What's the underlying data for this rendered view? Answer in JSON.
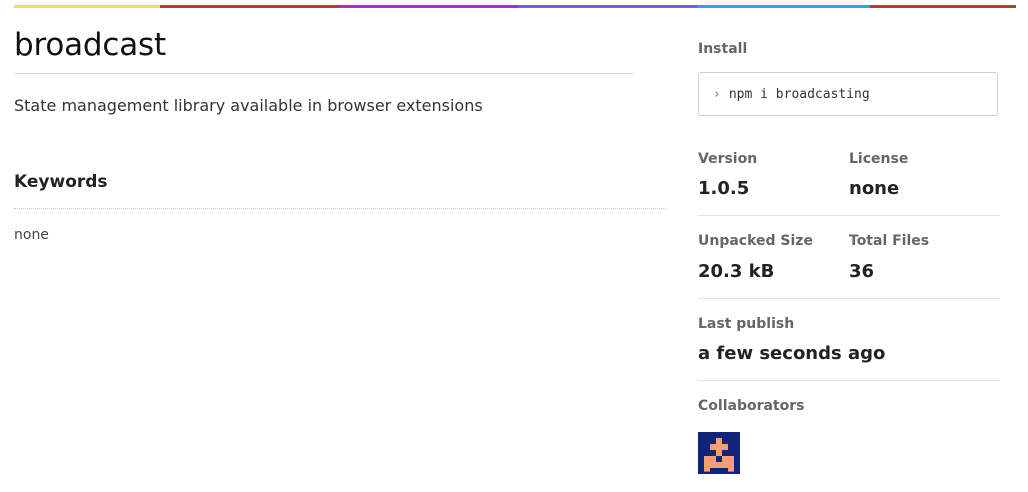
{
  "package": {
    "name": "broadcast",
    "description": "State management library available in browser extensions"
  },
  "keywords": {
    "heading": "Keywords",
    "value": "none"
  },
  "sidebar": {
    "install": {
      "label": "Install",
      "command": "npm i broadcasting",
      "prompt_icon": "chevron-right-icon"
    },
    "version": {
      "label": "Version",
      "value": "1.0.5"
    },
    "license": {
      "label": "License",
      "value": "none"
    },
    "unpacked_size": {
      "label": "Unpacked Size",
      "value": "20.3 kB"
    },
    "total_files": {
      "label": "Total Files",
      "value": "36"
    },
    "last_publish": {
      "label": "Last publish",
      "value": "a few seconds ago"
    },
    "collaborators": {
      "label": "Collaborators",
      "avatar_icon": "identicon-avatar"
    }
  },
  "theme": {
    "topbar_colors": [
      "#fbd865",
      "#c0392b",
      "#8e44ad",
      "#3498db",
      "#c0392b"
    ],
    "avatar_bg": "#10257a",
    "avatar_fg": "#f4a070"
  }
}
